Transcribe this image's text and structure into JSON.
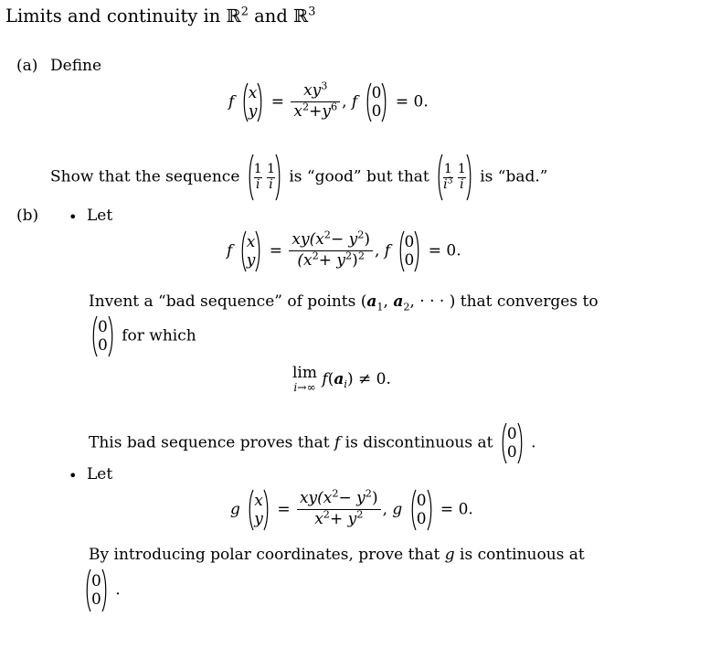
{
  "document": {
    "title": "Limits and continuity in",
    "title_space_1": "R",
    "title_sup_1": "2",
    "title_and": "and",
    "title_space_2": "R",
    "title_sup_2": "3"
  },
  "parts": {
    "a": {
      "label": "(a)",
      "lead": "Define",
      "equation": {
        "fn": "f",
        "arg_top": "x",
        "arg_bottom": "y",
        "equals": "=",
        "numerator": "xy",
        "numerator_sup": "3",
        "denominator_first": "x",
        "denominator_first_sup": "2",
        "denominator_plus": "+",
        "denominator_second": "y",
        "denominator_second_sup": "6",
        "comma": ",",
        "fn2": "f",
        "zero_top": "0",
        "zero_bottom": "0",
        "equals2": "=",
        "value": "0."
      },
      "sequence_text_1": "Show that the sequence",
      "sequence_vec_1": {
        "top_num": "1",
        "top_den": "i",
        "bottom_num": "1",
        "bottom_den": "i"
      },
      "sequence_text_2": "is “good” but that",
      "sequence_vec_2": {
        "top_num": "1",
        "top_den": "i",
        "top_den_sup": "3",
        "bottom_num": "1",
        "bottom_den": "i"
      },
      "sequence_text_3": "is “bad.”"
    },
    "b": {
      "label": "(b)",
      "bullet_1": {
        "lead": "Let",
        "equation": {
          "fn": "f",
          "arg_top": "x",
          "arg_bottom": "y",
          "equals": "=",
          "num_xy": "xy(x",
          "num_sup_1": "2",
          "num_minus": "− y",
          "num_sup_2": "2",
          "num_close": ")",
          "den_open": "(x",
          "den_sup_1": "2",
          "den_plus": "+ y",
          "den_sup_2": "2",
          "den_close": ")",
          "den_sup_3": "2",
          "comma": ",",
          "fn2": "f",
          "zero_top": "0",
          "zero_bottom": "0",
          "equals2": "=",
          "value": "0."
        },
        "invent_line_1": "Invent a “bad sequence” of points (",
        "invent_a1": "a",
        "invent_a1_sub": "1",
        "invent_comma1": ",",
        "invent_a2": "a",
        "invent_a2_sub": "2",
        "invent_dots": ", · · · ) that converges to",
        "invent_vec_top": "0",
        "invent_vec_bottom": "0",
        "invent_line_2": "for which",
        "limit": {
          "lim": "lim",
          "sublim_i": "i",
          "sublim_arrow": "→∞",
          "fn": "f",
          "open": "(",
          "arg": "a",
          "arg_sub": "i",
          "close": ")",
          "neq": "≠",
          "value": "0."
        },
        "proves_text_1": "This bad sequence proves that",
        "proves_fn": "f",
        "proves_text_2": "is discontinuous at",
        "proves_vec_top": "0",
        "proves_vec_bottom": "0",
        "proves_period": "."
      },
      "bullet_2": {
        "lead": "Let",
        "equation": {
          "fn": "g",
          "arg_top": "x",
          "arg_bottom": "y",
          "equals": "=",
          "num_xy": "xy(x",
          "num_sup_1": "2",
          "num_minus": "− y",
          "num_sup_2": "2",
          "num_close": ")",
          "den_open": "x",
          "den_sup_1": "2",
          "den_plus": "+ y",
          "den_sup_2": "2",
          "comma": ",",
          "fn2": "g",
          "zero_top": "0",
          "zero_bottom": "0",
          "equals2": "=",
          "value": "0."
        },
        "polar_text_1": "By introducing polar coordinates, prove that",
        "polar_fn": "g",
        "polar_text_2": "is continuous at",
        "polar_vec_top": "0",
        "polar_vec_bottom": "0",
        "polar_period": "."
      }
    }
  },
  "colors": {
    "text": "#000000",
    "background": "#ffffff"
  }
}
